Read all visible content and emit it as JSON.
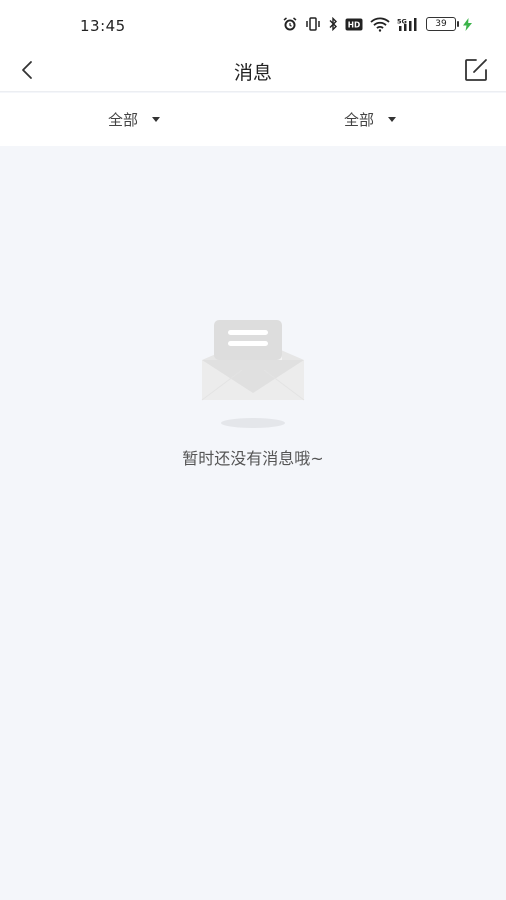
{
  "status_bar": {
    "time": "13:45",
    "battery_level": "39",
    "icons": [
      "alarm-icon",
      "vibrate-icon",
      "bluetooth-icon",
      "hd-icon",
      "wifi-icon",
      "5g-signal-icon",
      "battery-icon",
      "charging-icon"
    ],
    "hd_label": "HD",
    "network_label": "5G"
  },
  "header": {
    "title": "消息"
  },
  "filters": [
    {
      "label": "全部"
    },
    {
      "label": "全部"
    }
  ],
  "empty_state": {
    "message": "暂时还没有消息哦~"
  },
  "colors": {
    "background": "#f4f6fa",
    "surface": "#ffffff",
    "charge_green": "#3bb34a"
  }
}
